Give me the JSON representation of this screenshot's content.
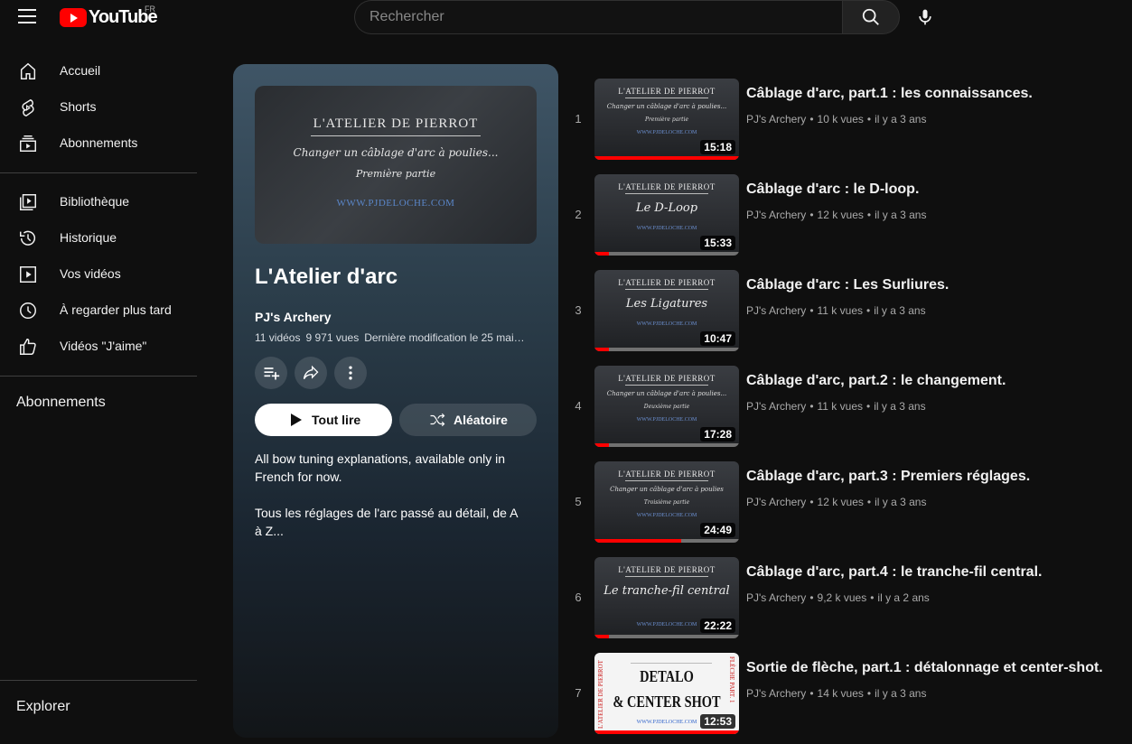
{
  "header": {
    "logo_text": "YouTube",
    "country": "FR",
    "search_placeholder": "Rechercher"
  },
  "sidebar": {
    "items": [
      {
        "label": "Accueil",
        "icon": "home-icon"
      },
      {
        "label": "Shorts",
        "icon": "shorts-icon"
      },
      {
        "label": "Abonnements",
        "icon": "subscriptions-icon"
      },
      {
        "label": "Bibliothèque",
        "icon": "library-icon"
      },
      {
        "label": "Historique",
        "icon": "history-icon"
      },
      {
        "label": "Vos vidéos",
        "icon": "your-videos-icon"
      },
      {
        "label": "À regarder plus tard",
        "icon": "watch-later-icon"
      },
      {
        "label": "Vidéos \"J'aime\"",
        "icon": "thumbs-up-icon"
      }
    ],
    "subscriptions_heading": "Abonnements",
    "explore_heading": "Explorer"
  },
  "playlist": {
    "thumb": {
      "line1": "L'ATELIER DE PIERROT",
      "line2": "Changer un câblage d'arc à poulies...",
      "line3": "Première partie",
      "line4": "WWW.PJDELOCHE.COM"
    },
    "title": "L'Atelier d'arc",
    "channel": "PJ's Archery",
    "video_count": "11 vidéos",
    "views": "9 971 vues",
    "modified": "Dernière modification le 25 mai…",
    "play_all_label": "Tout lire",
    "shuffle_label": "Aléatoire",
    "description_1": "All bow tuning explanations, available only in French for now.",
    "description_2": "Tous les réglages de l'arc passé au détail, de A à Z..."
  },
  "videos": [
    {
      "index": "1",
      "title": "Câblage d'arc, part.1 : les connaissances.",
      "channel": "PJ's Archery",
      "views": "10 k vues",
      "age": "il y a 3 ans",
      "duration": "15:18",
      "progress": 1.0,
      "thumb_l1": "L'ATELIER DE PIERROT",
      "thumb_l2": "Changer un câblage d'arc à poulies...",
      "thumb_l3": "Première partie",
      "thumb_l4": "WWW.PJDELOCHE.COM"
    },
    {
      "index": "2",
      "title": "Câblage d'arc : le D-loop.",
      "channel": "PJ's Archery",
      "views": "12 k vues",
      "age": "il y a 3 ans",
      "duration": "15:33",
      "progress": 0.1,
      "thumb_l1": "L'ATELIER DE PIERROT",
      "thumb_big": "Le D-Loop",
      "thumb_l4": "WWW.PJDELOCHE.COM"
    },
    {
      "index": "3",
      "title": "Câblage d'arc : Les Surliures.",
      "channel": "PJ's Archery",
      "views": "11 k vues",
      "age": "il y a 3 ans",
      "duration": "10:47",
      "progress": 0.1,
      "thumb_l1": "L'ATELIER DE PIERROT",
      "thumb_big": "Les Ligatures",
      "thumb_l4": "WWW.PJDELOCHE.COM"
    },
    {
      "index": "4",
      "title": "Câblage d'arc, part.2 : le changement.",
      "channel": "PJ's Archery",
      "views": "11 k vues",
      "age": "il y a 3 ans",
      "duration": "17:28",
      "progress": 0.1,
      "thumb_l1": "L'ATELIER DE PIERROT",
      "thumb_l2": "Changer un câblage d'arc à poulies...",
      "thumb_l3": "Deuxième partie",
      "thumb_l4": "WWW.PJDELOCHE.COM"
    },
    {
      "index": "5",
      "title": "Câblage d'arc, part.3 : Premiers réglages.",
      "channel": "PJ's Archery",
      "views": "12 k vues",
      "age": "il y a 3 ans",
      "duration": "24:49",
      "progress": 0.6,
      "thumb_l1": "L'ATELIER DE PIERROT",
      "thumb_l2": "Changer un câblage d'arc à poulies",
      "thumb_l3": "Troisième partie",
      "thumb_l4": "WWW.PJDELOCHE.COM"
    },
    {
      "index": "6",
      "title": "Câblage d'arc, part.4 : le tranche-fil central.",
      "channel": "PJ's Archery",
      "views": "9,2 k vues",
      "age": "il y a 2 ans",
      "duration": "22:22",
      "progress": 0.1,
      "thumb_l1": "L'ATELIER DE PIERROT",
      "thumb_big": "Le tranche-fil central",
      "thumb_l4": "WWW.PJDELOCHE.COM"
    },
    {
      "index": "7",
      "title": "Sortie de flèche, part.1 : détalonnage et center-shot.",
      "channel": "PJ's Archery",
      "views": "14 k vues",
      "age": "il y a 3 ans",
      "duration": "12:53",
      "progress": 1.0,
      "thumb_w1": "DETALO",
      "thumb_w2": "& CENTER SHOT",
      "thumb_side": "L'ATELIER DE PIERROT",
      "thumb_side2": "FLÈCHE PART. 1",
      "thumb_w3": "WWW.PJDELOCHE.COM"
    }
  ]
}
